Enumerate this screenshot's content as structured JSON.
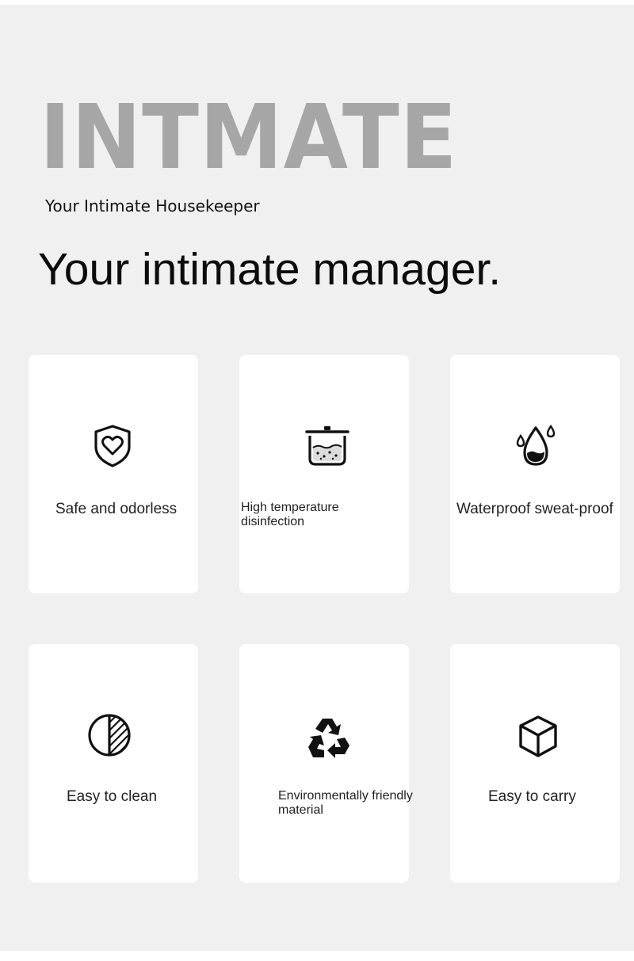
{
  "header": {
    "brand": "INTMATE",
    "brand_subtitle": "Your Intimate Housekeeper",
    "headline": "Your intimate manager."
  },
  "features": [
    {
      "icon": "shield-heart-icon",
      "label": "Safe and odorless"
    },
    {
      "icon": "pot-icon",
      "label": "High temperature disinfection"
    },
    {
      "icon": "water-drop-icon",
      "label": "Waterproof sweat-proof"
    },
    {
      "icon": "half-circle-icon",
      "label": "Easy to clean"
    },
    {
      "icon": "recycle-icon",
      "label": "Environmentally friendly material"
    },
    {
      "icon": "cube-icon",
      "label": "Easy to carry"
    }
  ]
}
